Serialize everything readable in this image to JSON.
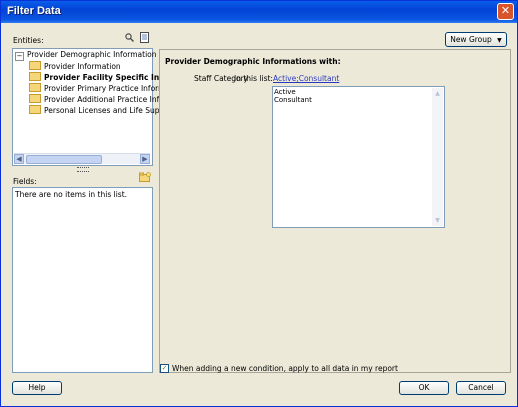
{
  "window": {
    "title": "Filter Data",
    "close_glyph": "✕"
  },
  "entities": {
    "label": "Entities:",
    "search_icon": "search-icon",
    "doc_icon": "document-icon",
    "tree": {
      "root": "Provider Demographic Information",
      "children": [
        "Provider Information",
        "Provider Facility Specific Info",
        "Provider Primary Practice Informa",
        "Provider Additional Practice Inform",
        "Personal Licenses and Life Suppor"
      ],
      "bold_index": 1
    },
    "scroll_left": "◀",
    "scroll_right": "▶"
  },
  "fields": {
    "label": "Fields:",
    "empty_text": "There are no items in this list.",
    "icon": "new-folder-icon"
  },
  "new_group_button": {
    "label": "New Group",
    "arrow": "▼"
  },
  "condition_panel": {
    "title": "Provider Demographic Informations with:",
    "field_label": "Staff Category",
    "operator": "In this list:",
    "value_link": "Active;Consultant",
    "list_items": [
      "Active",
      "Consultant"
    ],
    "scroll_up": "▲",
    "scroll_down": "▼"
  },
  "apply_all": {
    "checked": "✓",
    "label": "When adding a new condition, apply to all data in my report"
  },
  "buttons": {
    "help": "Help",
    "ok": "OK",
    "cancel": "Cancel"
  }
}
